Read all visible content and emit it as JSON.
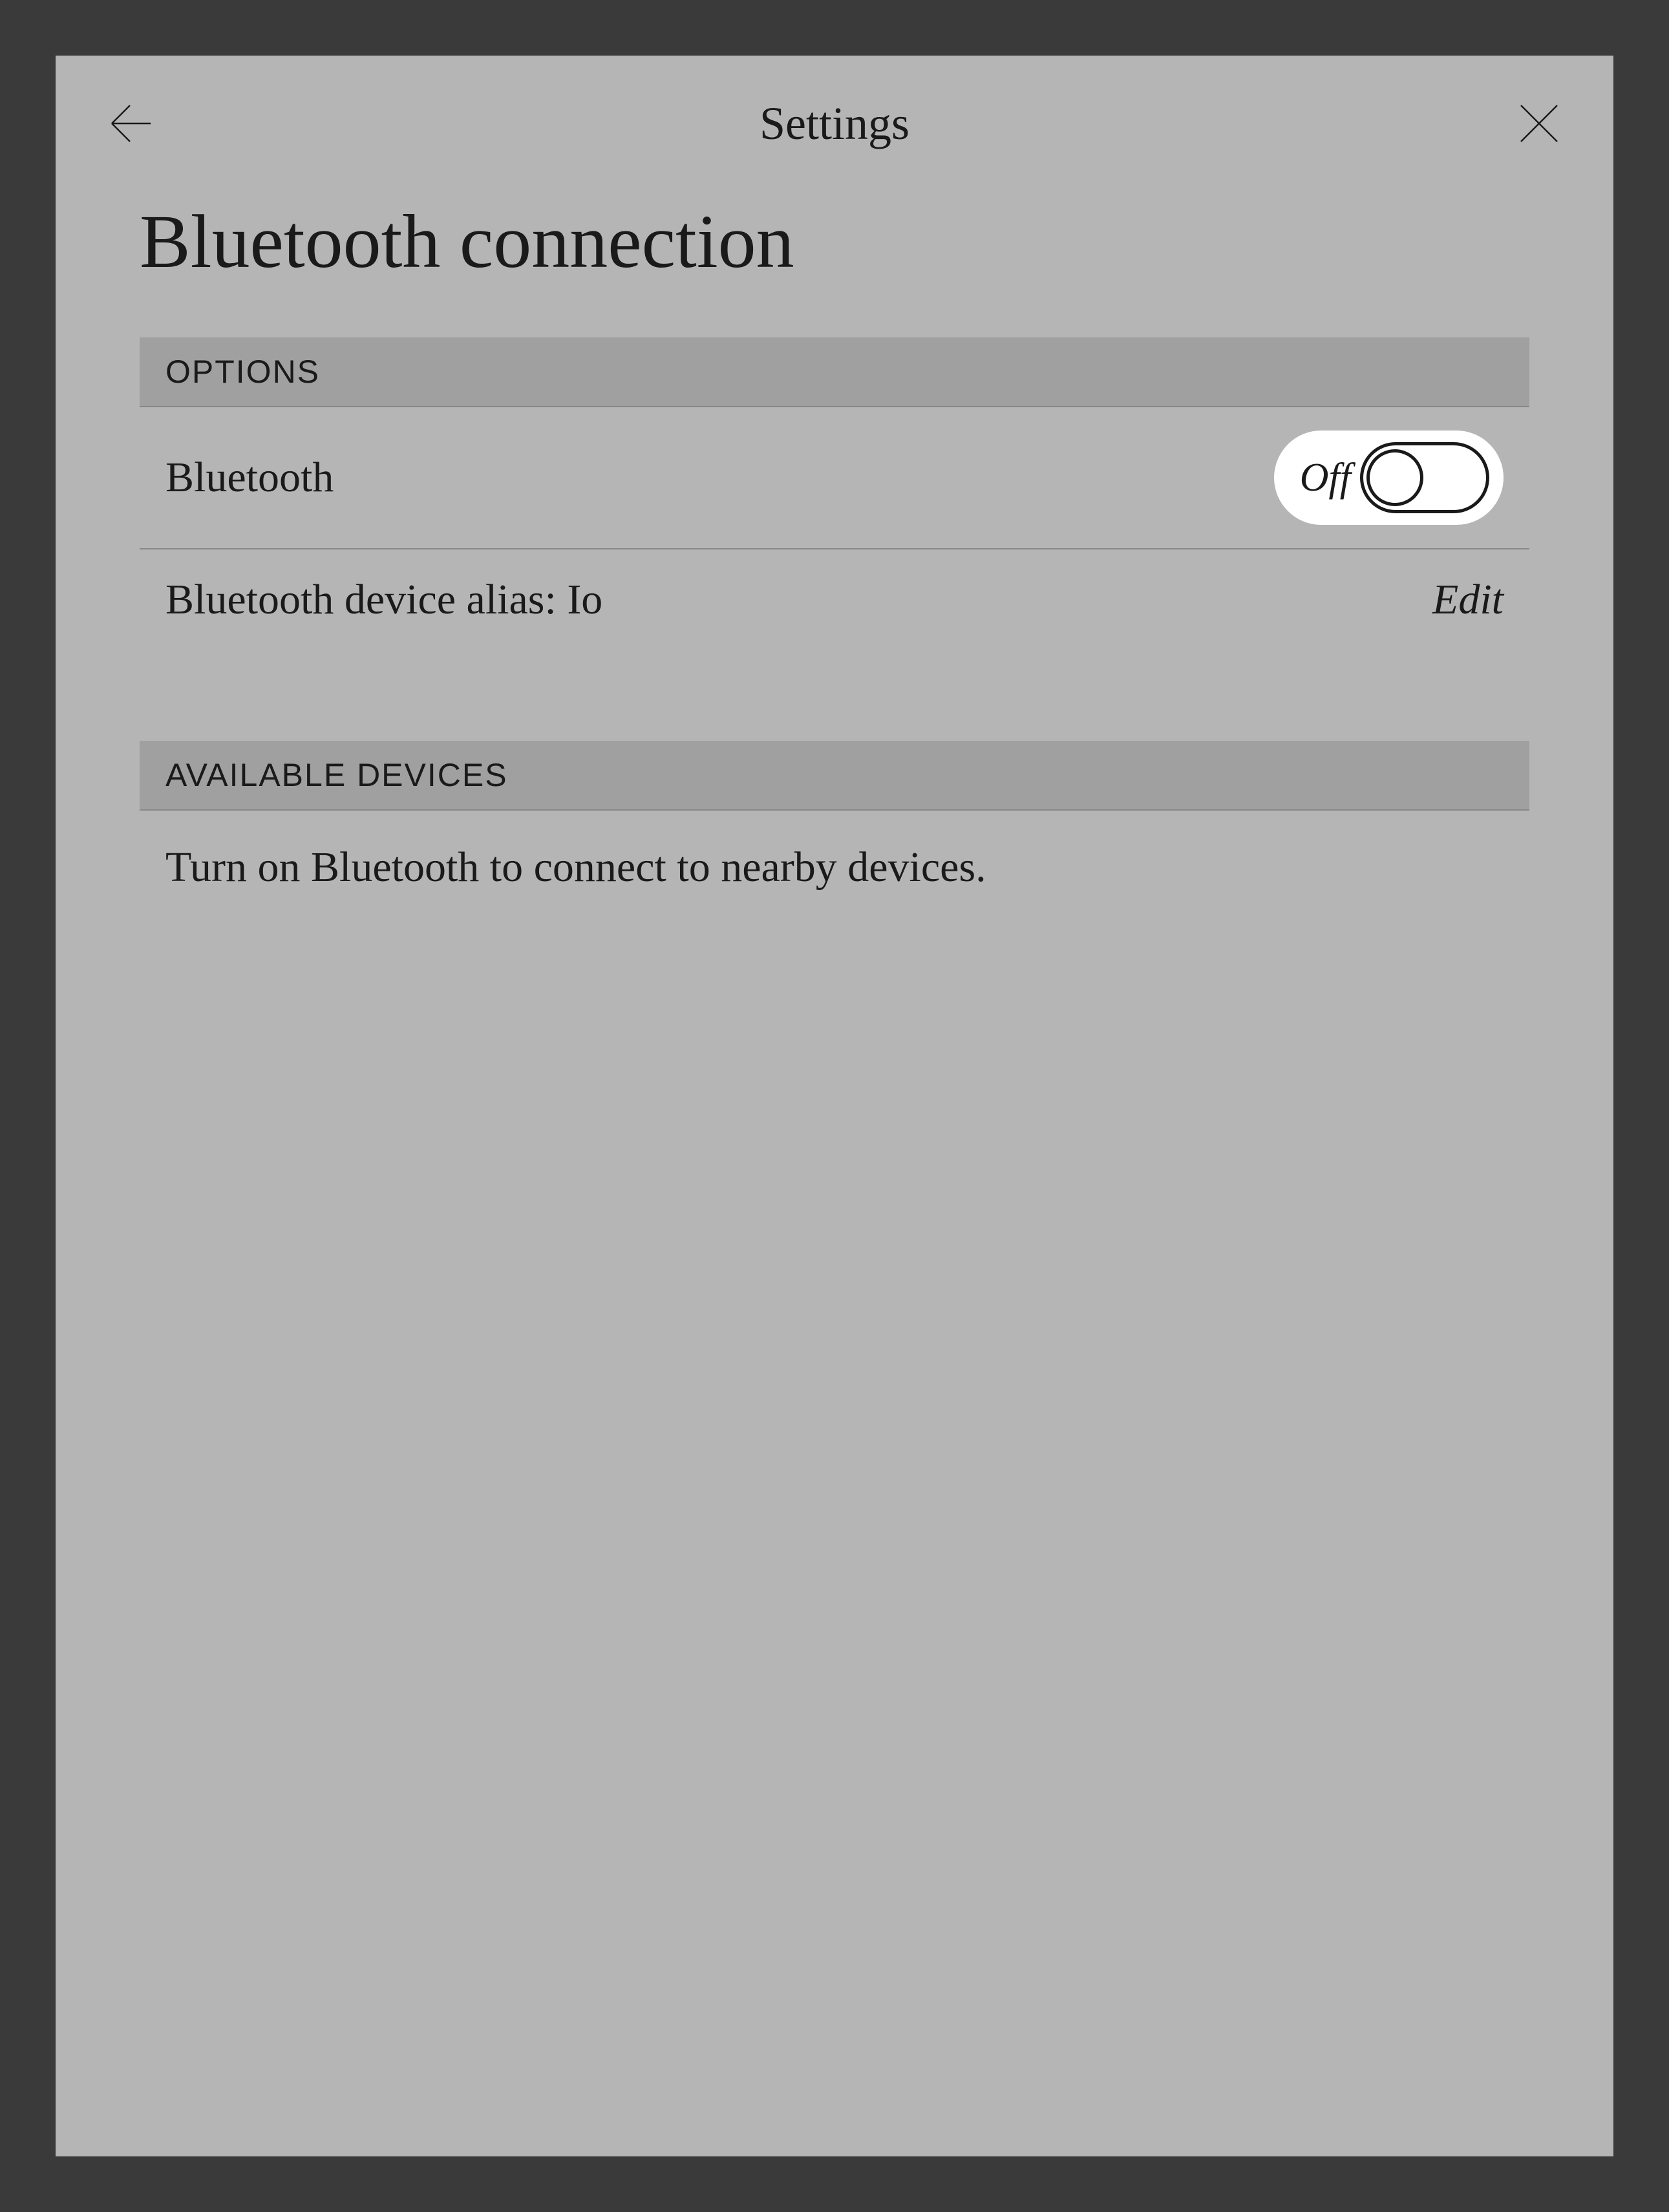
{
  "header": {
    "title": "Settings"
  },
  "page": {
    "title": "Bluetooth connection"
  },
  "sections": {
    "options": {
      "header": "OPTIONS",
      "bluetooth": {
        "label": "Bluetooth",
        "toggle_state": "Off"
      },
      "alias": {
        "label": "Bluetooth device alias: Io",
        "action": "Edit"
      }
    },
    "available_devices": {
      "header": "AVAILABLE DEVICES",
      "message": "Turn on Bluetooth to connect to nearby devices."
    }
  }
}
